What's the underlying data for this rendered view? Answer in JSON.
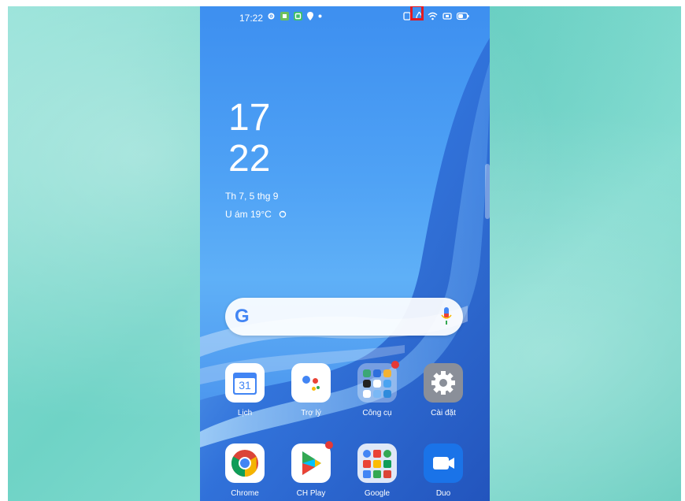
{
  "status_bar": {
    "time": "17:22",
    "left_icons": [
      "gear-icon",
      "app-notification-icon",
      "green-notification-icon",
      "location-icon",
      "dot-icon"
    ],
    "right_icons": [
      "nfc-icon",
      "drop-icon",
      "wifi-icon",
      "vpn-icon",
      "battery-icon"
    ]
  },
  "clock": {
    "hour": "17",
    "minute": "22"
  },
  "date": "Th 7, 5 thg 9",
  "weather": "U ám 19°C",
  "search": {
    "logo": "G"
  },
  "apps_row1": [
    {
      "label": "Lịch",
      "icon": "calendar-icon",
      "badge": false,
      "date_num": "31"
    },
    {
      "label": "Trợ lý",
      "icon": "assistant-icon",
      "badge": false
    },
    {
      "label": "Công cụ",
      "icon": "folder-icon",
      "badge": true
    },
    {
      "label": "Cài đặt",
      "icon": "settings-icon",
      "badge": false
    }
  ],
  "apps_row2": [
    {
      "label": "Chrome",
      "icon": "chrome-icon",
      "badge": false
    },
    {
      "label": "CH Play",
      "icon": "play-store-icon",
      "badge": true
    },
    {
      "label": "Google",
      "icon": "google-folder-icon",
      "badge": false
    },
    {
      "label": "Duo",
      "icon": "duo-icon",
      "badge": false
    }
  ],
  "colors": {
    "highlight": "#e11b22",
    "accent": "#4285F4"
  }
}
